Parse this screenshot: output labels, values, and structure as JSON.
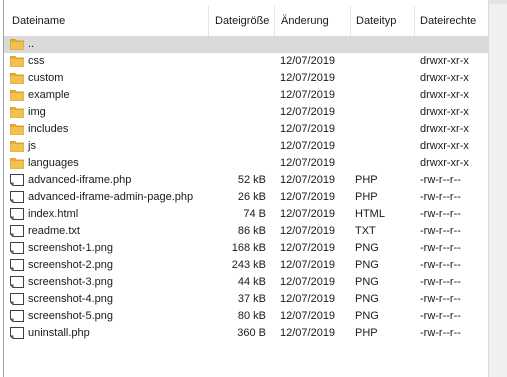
{
  "columns": {
    "name": "Dateiname",
    "size": "Dateigröße",
    "modified": "Änderung",
    "type": "Dateityp",
    "permissions": "Dateirechte"
  },
  "colors": {
    "folder": "#e8b02a",
    "folder_dark": "#c9911a",
    "selected_row": "#d9d9d9"
  },
  "rows": [
    {
      "icon": "folder-icon",
      "name": "..",
      "size": "",
      "modified": "",
      "type": "",
      "permissions": "",
      "selected": true
    },
    {
      "icon": "folder-icon",
      "name": "css",
      "size": "",
      "modified": "12/07/2019",
      "type": "",
      "permissions": "drwxr-xr-x"
    },
    {
      "icon": "folder-icon",
      "name": "custom",
      "size": "",
      "modified": "12/07/2019",
      "type": "",
      "permissions": "drwxr-xr-x"
    },
    {
      "icon": "folder-icon",
      "name": "example",
      "size": "",
      "modified": "12/07/2019",
      "type": "",
      "permissions": "drwxr-xr-x"
    },
    {
      "icon": "folder-icon",
      "name": "img",
      "size": "",
      "modified": "12/07/2019",
      "type": "",
      "permissions": "drwxr-xr-x"
    },
    {
      "icon": "folder-icon",
      "name": "includes",
      "size": "",
      "modified": "12/07/2019",
      "type": "",
      "permissions": "drwxr-xr-x"
    },
    {
      "icon": "folder-icon",
      "name": "js",
      "size": "",
      "modified": "12/07/2019",
      "type": "",
      "permissions": "drwxr-xr-x"
    },
    {
      "icon": "folder-icon",
      "name": "languages",
      "size": "",
      "modified": "12/07/2019",
      "type": "",
      "permissions": "drwxr-xr-x"
    },
    {
      "icon": "file-icon",
      "name": "advanced-iframe.php",
      "size": "52 kB",
      "modified": "12/07/2019",
      "type": "PHP",
      "permissions": "-rw-r--r--"
    },
    {
      "icon": "file-icon",
      "name": "advanced-iframe-admin-page.php",
      "size": "26 kB",
      "modified": "12/07/2019",
      "type": "PHP",
      "permissions": "-rw-r--r--"
    },
    {
      "icon": "file-icon",
      "name": "index.html",
      "size": "74 B",
      "modified": "12/07/2019",
      "type": "HTML",
      "permissions": "-rw-r--r--"
    },
    {
      "icon": "file-icon",
      "name": "readme.txt",
      "size": "86 kB",
      "modified": "12/07/2019",
      "type": "TXT",
      "permissions": "-rw-r--r--"
    },
    {
      "icon": "file-icon",
      "name": "screenshot-1.png",
      "size": "168 kB",
      "modified": "12/07/2019",
      "type": "PNG",
      "permissions": "-rw-r--r--"
    },
    {
      "icon": "file-icon",
      "name": "screenshot-2.png",
      "size": "243 kB",
      "modified": "12/07/2019",
      "type": "PNG",
      "permissions": "-rw-r--r--"
    },
    {
      "icon": "file-icon",
      "name": "screenshot-3.png",
      "size": "44 kB",
      "modified": "12/07/2019",
      "type": "PNG",
      "permissions": "-rw-r--r--"
    },
    {
      "icon": "file-icon",
      "name": "screenshot-4.png",
      "size": "37 kB",
      "modified": "12/07/2019",
      "type": "PNG",
      "permissions": "-rw-r--r--"
    },
    {
      "icon": "file-icon",
      "name": "screenshot-5.png",
      "size": "80 kB",
      "modified": "12/07/2019",
      "type": "PNG",
      "permissions": "-rw-r--r--"
    },
    {
      "icon": "file-icon",
      "name": "uninstall.php",
      "size": "360 B",
      "modified": "12/07/2019",
      "type": "PHP",
      "permissions": "-rw-r--r--"
    }
  ]
}
